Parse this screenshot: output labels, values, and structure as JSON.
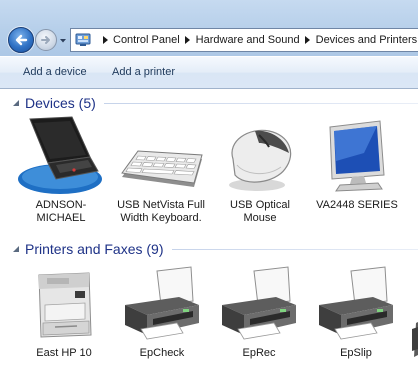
{
  "address_bar": {
    "crumbs": [
      "Control Panel",
      "Hardware and Sound",
      "Devices and Printers"
    ]
  },
  "toolbar": {
    "add_device": "Add a device",
    "add_printer": "Add a printer"
  },
  "groups": {
    "devices": {
      "title": "Devices (5)",
      "items": [
        {
          "label": "ADNSON-MICHAEL",
          "icon": "laptop-icon"
        },
        {
          "label": "USB NetVista Full Width Keyboard.",
          "icon": "keyboard-icon"
        },
        {
          "label": "USB Optical Mouse",
          "icon": "mouse-icon"
        },
        {
          "label": "VA2448 SERIES",
          "icon": "monitor-icon"
        }
      ]
    },
    "printers": {
      "title": "Printers and Faxes (9)",
      "items": [
        {
          "label": "East HP 10",
          "icon": "laser-printer-icon"
        },
        {
          "label": "EpCheck",
          "icon": "printer-icon"
        },
        {
          "label": "EpRec",
          "icon": "printer-icon"
        },
        {
          "label": "EpSlip",
          "icon": "printer-icon"
        }
      ]
    }
  },
  "colors": {
    "group_title": "#1e3287",
    "toolbar_text": "#1e395b",
    "address_bg": "#b6cfea"
  }
}
